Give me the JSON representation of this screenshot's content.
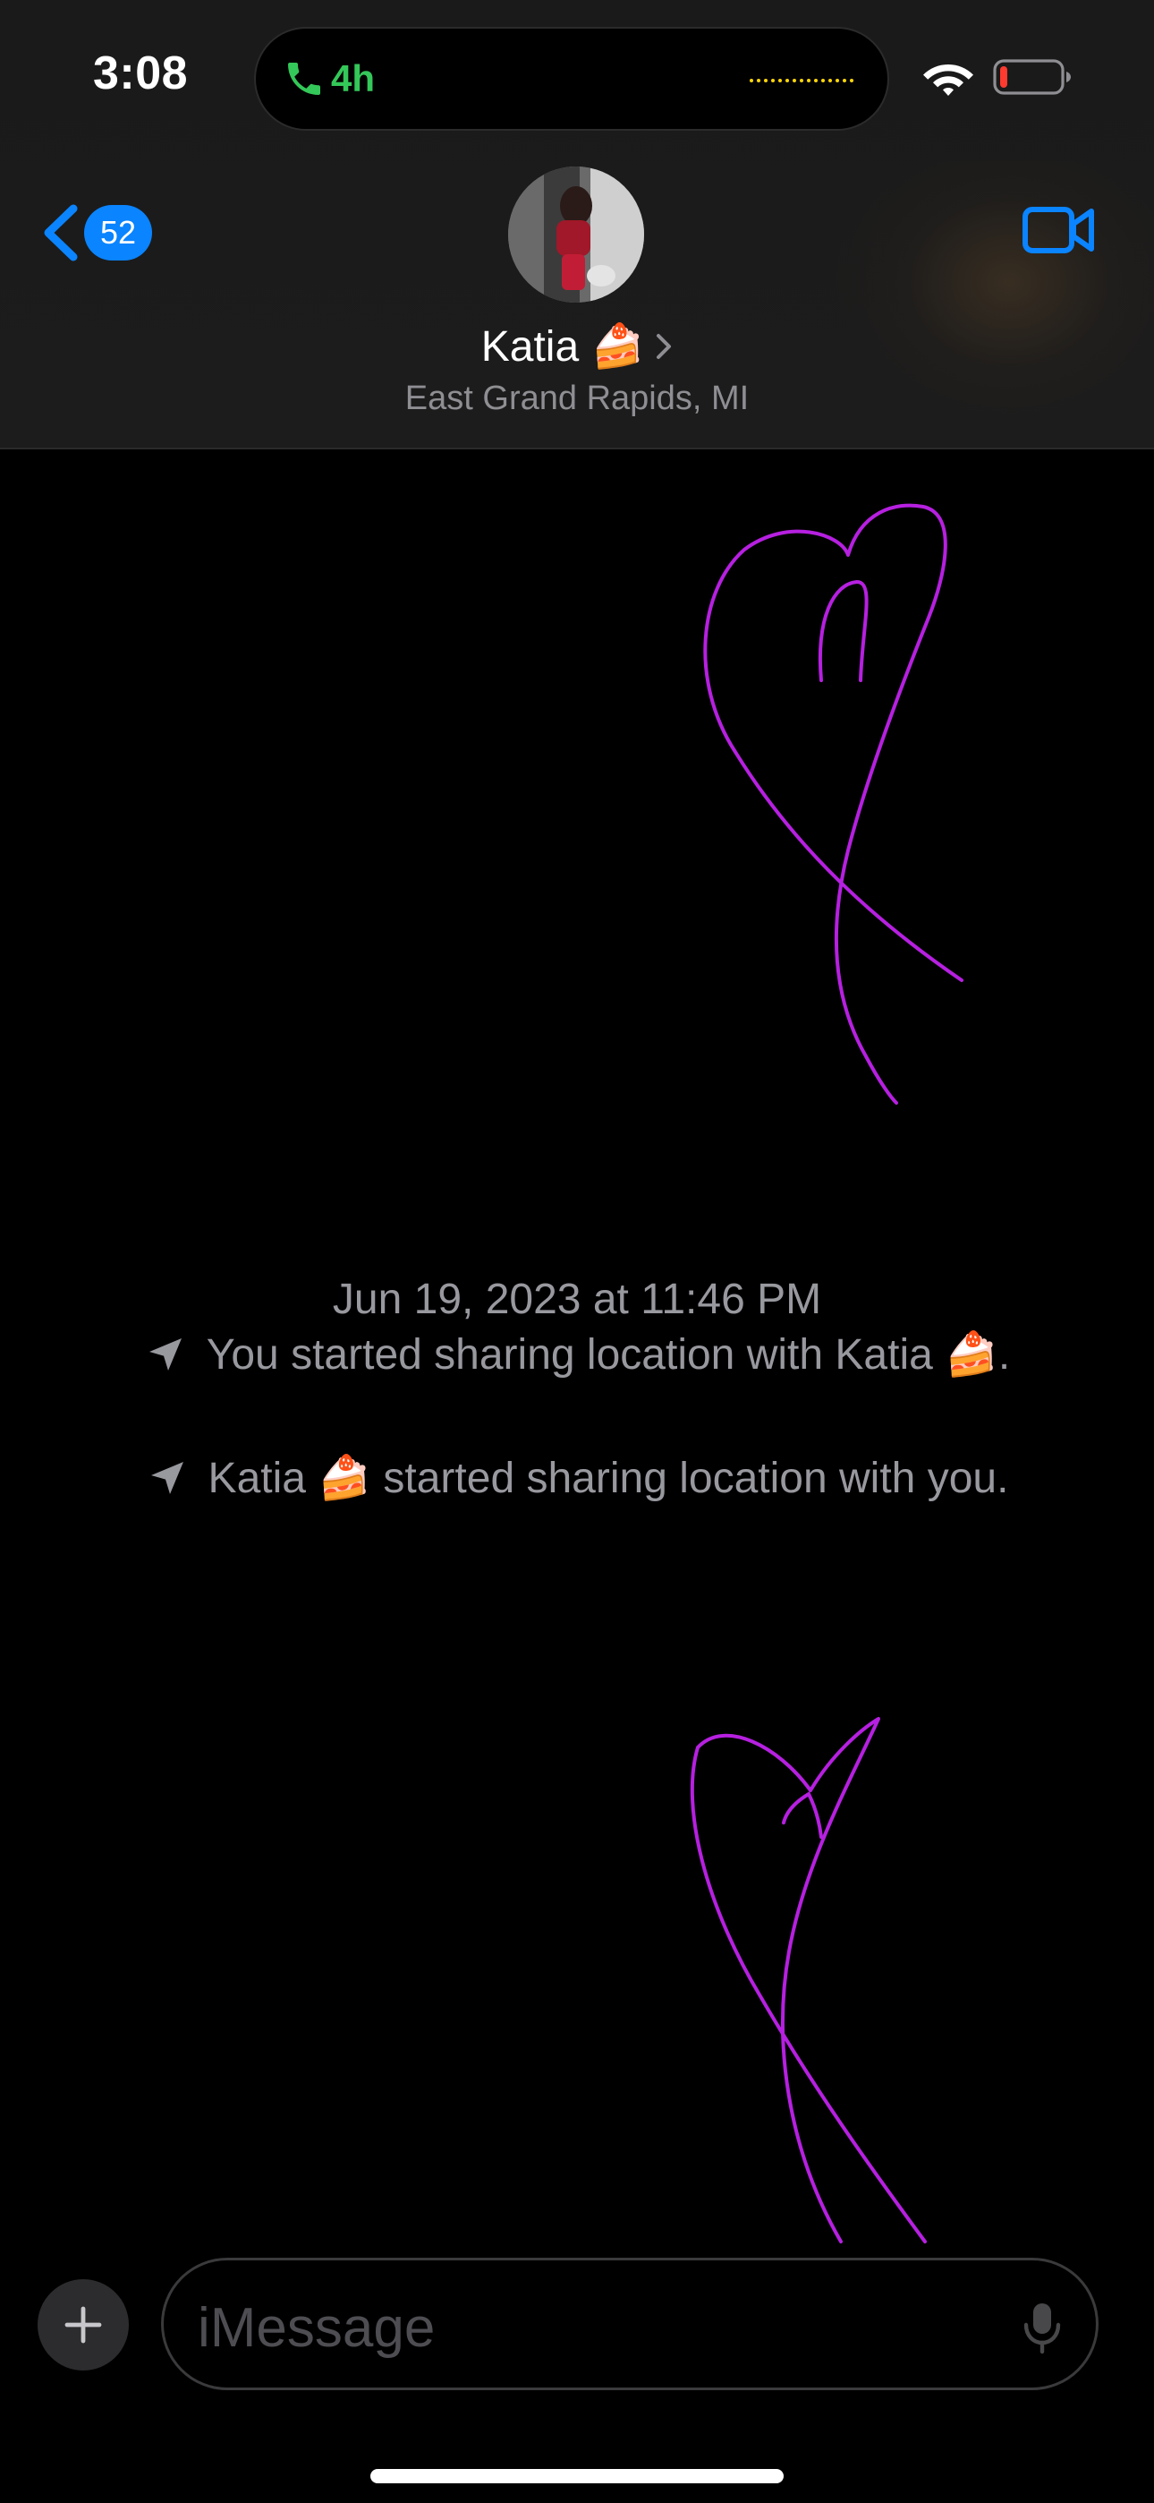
{
  "status_bar": {
    "time": "3:08",
    "call_duration": "4h"
  },
  "header": {
    "back_badge_count": "52",
    "contact_name": "Katia 🍰",
    "contact_location": "East Grand Rapids, MI"
  },
  "conversation": {
    "date": "Jun 19, 2023",
    "date_connector": "at",
    "time": "11:46 PM",
    "events": [
      {
        "icon": "location-arrow-icon",
        "text": "You started sharing location with Katia 🍰."
      },
      {
        "icon": "location-arrow-icon",
        "text": "Katia 🍰 started sharing location with you."
      }
    ],
    "sketch_color": "#b620e0"
  },
  "composer": {
    "placeholder": "iMessage"
  },
  "colors": {
    "accent_blue": "#0a84ff",
    "call_green": "#34c759",
    "battery_red": "#ff3b30",
    "secondary_text": "#98989f"
  }
}
